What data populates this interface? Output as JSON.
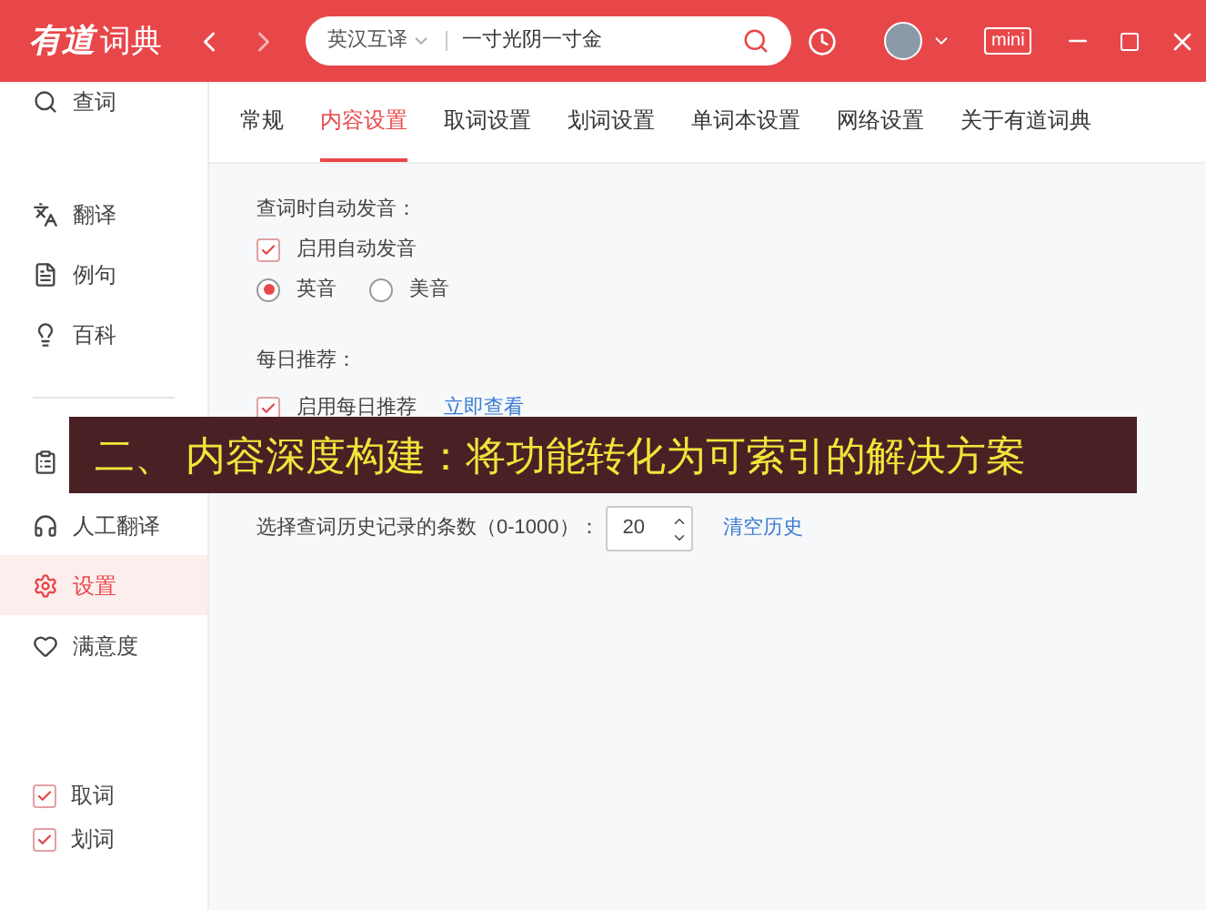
{
  "header": {
    "logo_brand": "有道",
    "logo_product": "词典",
    "search": {
      "language": "英汉互译",
      "value": "一寸光阴一寸金"
    },
    "mini_label": "mini"
  },
  "sidebar": {
    "items": [
      {
        "kind": "search",
        "label": "查词",
        "selected": false
      },
      {
        "kind": "translate",
        "label": "翻译",
        "selected": false
      },
      {
        "kind": "sentence",
        "label": "例句",
        "selected": false
      },
      {
        "kind": "wiki",
        "label": "百科",
        "selected": false
      },
      {
        "kind": "divider"
      },
      {
        "kind": "clipboard",
        "selected": false
      },
      {
        "kind": "human",
        "label": "人工翻译",
        "selected": false
      },
      {
        "kind": "settings",
        "label": "设置",
        "selected": true
      },
      {
        "kind": "heart",
        "label": "满意度",
        "selected": false
      }
    ],
    "toggles": [
      {
        "label": "取词",
        "checked": true
      },
      {
        "label": "划词",
        "checked": true
      }
    ]
  },
  "tabs": [
    {
      "label": "常规",
      "selected": false
    },
    {
      "label": "内容设置",
      "selected": true
    },
    {
      "label": "取词设置",
      "selected": false
    },
    {
      "label": "划词设置",
      "selected": false
    },
    {
      "label": "单词本设置",
      "selected": false
    },
    {
      "label": "网络设置",
      "selected": false
    },
    {
      "label": "关于有道词典",
      "selected": false
    }
  ],
  "content": {
    "auto_voice": {
      "title": "查词时自动发音：",
      "checkbox": {
        "label": "启用自动发音",
        "checked": true
      },
      "radios": [
        {
          "label": "英音",
          "selected": true
        },
        {
          "label": "美音",
          "selected": false
        }
      ]
    },
    "daily": {
      "title": "每日推荐：",
      "checkbox": {
        "label": "启用每日推荐",
        "checked": true
      },
      "link": "立即查看"
    },
    "history": {
      "label": "选择查词历史记录的条数（0-1000）：",
      "value": "20",
      "link": "清空历史"
    }
  },
  "banner": "二、 内容深度构建：将功能转化为可索引的解决方案"
}
